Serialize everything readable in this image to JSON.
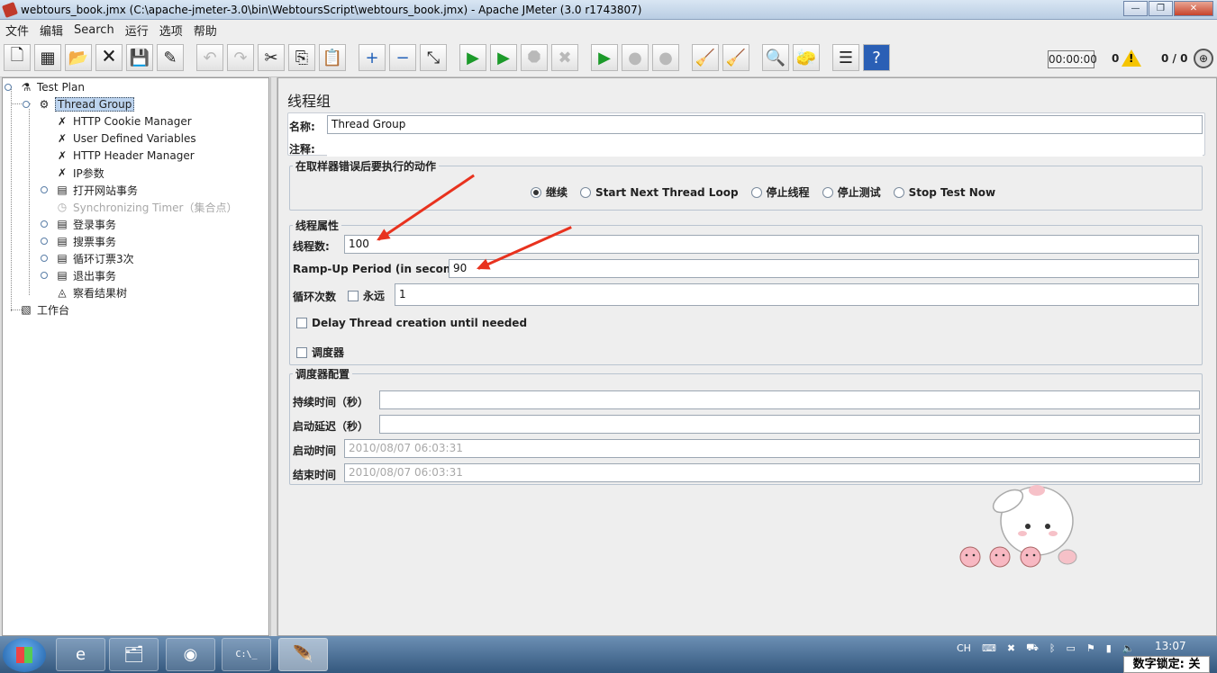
{
  "window": {
    "title": "webtours_book.jmx (C:\\apache-jmeter-3.0\\bin\\WebtoursScript\\webtours_book.jmx) - Apache JMeter (3.0 r1743807)",
    "controls": [
      "—",
      "❐",
      "✕"
    ]
  },
  "menu": [
    "文件",
    "编辑",
    "Search",
    "运行",
    "选项",
    "帮助"
  ],
  "toolbar": {
    "buttons": [
      {
        "name": "new-icon",
        "glyph": "🗋"
      },
      {
        "name": "templates-icon",
        "glyph": "▦"
      },
      {
        "name": "open-icon",
        "glyph": "📂"
      },
      {
        "name": "close-icon",
        "glyph": "🗙"
      },
      {
        "name": "save-icon",
        "glyph": "💾"
      },
      {
        "name": "save-screenshot-icon",
        "glyph": "✎"
      },
      {
        "name": "undo-icon",
        "glyph": "↶"
      },
      {
        "name": "redo-icon",
        "glyph": "↷"
      },
      {
        "name": "cut-icon",
        "glyph": "✂"
      },
      {
        "name": "copy-icon",
        "glyph": "⎘"
      },
      {
        "name": "paste-icon",
        "glyph": "📋"
      },
      {
        "name": "expand-icon",
        "glyph": "+"
      },
      {
        "name": "collapse-icon",
        "glyph": "−"
      },
      {
        "name": "toggle-icon",
        "glyph": "⤡"
      },
      {
        "name": "start-icon",
        "glyph": "▶"
      },
      {
        "name": "start-no-pause-icon",
        "glyph": "▶"
      },
      {
        "name": "stop-icon",
        "glyph": "⯃"
      },
      {
        "name": "shutdown-icon",
        "glyph": "✖"
      },
      {
        "name": "remote-start-icon",
        "glyph": "▶"
      },
      {
        "name": "remote-stop-icon",
        "glyph": "●"
      },
      {
        "name": "remote-exit-icon",
        "glyph": "●"
      },
      {
        "name": "clear-icon",
        "glyph": "🧹"
      },
      {
        "name": "clear-all-icon",
        "glyph": "🧹"
      },
      {
        "name": "search-icon",
        "glyph": "🔍"
      },
      {
        "name": "reset-search-icon",
        "glyph": "🧽"
      },
      {
        "name": "function-helper-icon",
        "glyph": "☰"
      },
      {
        "name": "help-icon",
        "glyph": "?"
      }
    ],
    "timer": "00:00:00",
    "warnings": "0",
    "threads": "0 / 0"
  },
  "tree": [
    {
      "label": "Test Plan",
      "icon": "flask-icon",
      "glyph": "⚗"
    },
    {
      "label": "Thread Group",
      "icon": "gear-icon",
      "glyph": "⚙",
      "selected": true
    },
    {
      "label": "HTTP Cookie Manager",
      "icon": "wrench-icon",
      "glyph": "✗"
    },
    {
      "label": "User Defined Variables",
      "icon": "wrench-icon",
      "glyph": "✗"
    },
    {
      "label": "HTTP Header Manager",
      "icon": "wrench-icon",
      "glyph": "✗"
    },
    {
      "label": "IP参数",
      "icon": "wrench-icon",
      "glyph": "✗"
    },
    {
      "label": "打开网站事务",
      "icon": "transaction-icon",
      "glyph": "▤"
    },
    {
      "label": "Synchronizing Timer（集合点）",
      "icon": "timer-icon",
      "glyph": "◷",
      "disabled": true
    },
    {
      "label": "登录事务",
      "icon": "transaction-icon",
      "glyph": "▤"
    },
    {
      "label": "搜票事务",
      "icon": "transaction-icon",
      "glyph": "▤"
    },
    {
      "label": "循环订票3次",
      "icon": "transaction-icon",
      "glyph": "▤"
    },
    {
      "label": "退出事务",
      "icon": "transaction-icon",
      "glyph": "▤"
    },
    {
      "label": "察看结果树",
      "icon": "chart-icon",
      "glyph": "◬"
    },
    {
      "label": "工作台",
      "icon": "workbench-icon",
      "glyph": "▧"
    }
  ],
  "panel": {
    "title": "线程组",
    "name_label": "名称:",
    "name_value": "Thread Group",
    "comment_label": "注释:",
    "comment_value": "",
    "error_group": {
      "legend": "在取样器错误后要执行的动作",
      "options": [
        "继续",
        "Start Next Thread Loop",
        "停止线程",
        "停止测试",
        "Stop Test Now"
      ],
      "selected": "继续"
    },
    "thread_props": {
      "legend": "线程属性",
      "threads_label": "线程数:",
      "threads_value": "100",
      "rampup_label": "Ramp-Up Period (in seconds):",
      "rampup_value": "90",
      "loop_label": "循环次数",
      "forever_label": "永远",
      "loop_value": "1",
      "delay_label": "Delay Thread creation until needed",
      "scheduler_label": "调度器"
    },
    "scheduler": {
      "legend": "调度器配置",
      "duration_label": "持续时间（秒）",
      "duration_value": "",
      "delay_label": "启动延迟（秒）",
      "delay_value": "",
      "start_label": "启动时间",
      "start_value": "2010/08/07 06:03:31",
      "end_label": "结束时间",
      "end_value": "2010/08/07 06:03:31"
    }
  },
  "taskbar": {
    "apps": [
      {
        "name": "ie-taskbar-button",
        "glyph": "e"
      },
      {
        "name": "explorer-taskbar-button",
        "glyph": "🗂"
      },
      {
        "name": "chrome-taskbar-button",
        "glyph": "◉"
      },
      {
        "name": "cmd-taskbar-button",
        "glyph": "C:\\_"
      },
      {
        "name": "jmeter-taskbar-button",
        "glyph": "🪶"
      }
    ],
    "tray": [
      "CH",
      "⌨",
      "✖",
      "⛟",
      "ᛒ",
      "▭",
      "⚑",
      "▮",
      "🔈"
    ],
    "clock": "13:07",
    "numlock": "数字锁定: 关"
  },
  "colors": {
    "accent": "#bcd3ee",
    "arrow": "#e8321e",
    "panel_bg": "#eeeeee"
  }
}
